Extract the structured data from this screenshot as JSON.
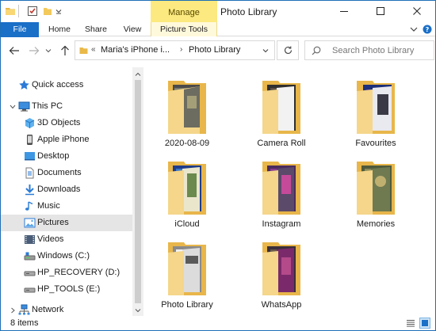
{
  "window": {
    "title": "Photo Library",
    "context_tab": "Manage",
    "context_group": "Picture Tools"
  },
  "ribbon": {
    "tabs": [
      "File",
      "Home",
      "Share",
      "View",
      "Picture Tools"
    ]
  },
  "address": {
    "segments": [
      "Maria's iPhone i...",
      "Photo Library"
    ],
    "search_placeholder": "Search Photo Library"
  },
  "sidebar": {
    "items": [
      {
        "label": "Quick access",
        "icon": "star-icon",
        "selected": false
      },
      {
        "label": "This PC",
        "icon": "computer-icon",
        "selected": false
      },
      {
        "label": "3D Objects",
        "icon": "cube-icon",
        "selected": false
      },
      {
        "label": "Apple iPhone",
        "icon": "phone-icon",
        "selected": false
      },
      {
        "label": "Desktop",
        "icon": "desktop-icon",
        "selected": false
      },
      {
        "label": "Documents",
        "icon": "document-icon",
        "selected": false
      },
      {
        "label": "Downloads",
        "icon": "download-icon",
        "selected": false
      },
      {
        "label": "Music",
        "icon": "music-icon",
        "selected": false
      },
      {
        "label": "Pictures",
        "icon": "pictures-icon",
        "selected": true
      },
      {
        "label": "Videos",
        "icon": "videos-icon",
        "selected": false
      },
      {
        "label": "Windows (C:)",
        "icon": "drive-icon",
        "selected": false
      },
      {
        "label": "HP_RECOVERY (D:)",
        "icon": "drive-icon",
        "selected": false
      },
      {
        "label": "HP_TOOLS (E:)",
        "icon": "drive-icon",
        "selected": false
      },
      {
        "label": "Network",
        "icon": "network-icon",
        "selected": false
      }
    ]
  },
  "folders": [
    {
      "name": "2020-08-09"
    },
    {
      "name": "Camera Roll"
    },
    {
      "name": "Favourites"
    },
    {
      "name": "iCloud"
    },
    {
      "name": "Instagram"
    },
    {
      "name": "Memories"
    },
    {
      "name": "Photo Library"
    },
    {
      "name": "WhatsApp"
    }
  ],
  "status": {
    "item_count": "8 items"
  },
  "colors": {
    "accent": "#1a6fc7",
    "manage_tab": "#fce97f",
    "folder": "#f5d68a",
    "selected": "#e5e5e5"
  }
}
